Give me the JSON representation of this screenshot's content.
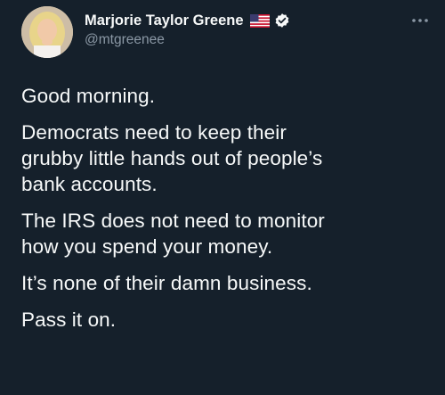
{
  "author": {
    "display_name": "Marjorie Taylor Greene",
    "flag_icon": "us-flag-icon",
    "verified_icon": "verified-badge-icon",
    "handle": "@mtgreenee"
  },
  "menu": {
    "icon": "more-dots-icon"
  },
  "tweet": {
    "paragraphs": [
      "Good morning.",
      "Democrats need to keep their\ngrubby little hands out of people’s\nbank accounts.",
      "The IRS does not need to monitor\nhow you spend your money.",
      "It’s none of their damn business.",
      "Pass it on."
    ]
  },
  "colors": {
    "background": "#15202b",
    "text": "#f7f9f9",
    "muted": "#8b98a5"
  }
}
